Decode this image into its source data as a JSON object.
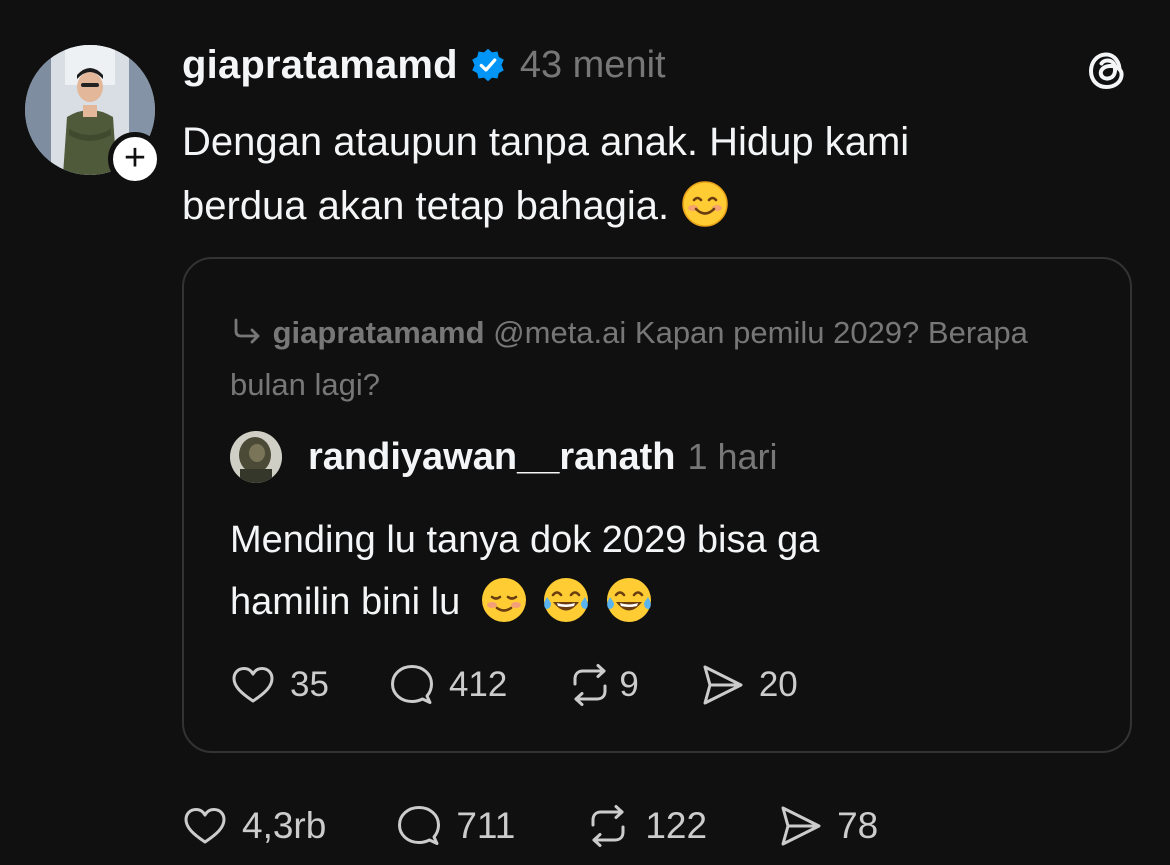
{
  "post": {
    "username": "giapratamamd",
    "time": "43 menit",
    "text_line1": "Dengan ataupun tanpa anak.  Hidup kami",
    "text_line2": "berdua akan tetap bahagia.",
    "follow_symbol": "+"
  },
  "quote": {
    "reply_user": "giapratamamd",
    "reply_text": "@meta.ai Kapan pemilu 2029? Berapa bulan lagi?",
    "username": "randiyawan__ranath",
    "time": "1 hari",
    "text_line1": "Mending lu tanya dok 2029 bisa ga",
    "text_line2": "hamilin bini lu",
    "likes": "35",
    "replies": "412",
    "reposts": "9",
    "shares": "20"
  },
  "actions": {
    "likes": "4,3rb",
    "replies": "711",
    "reposts": "122",
    "shares": "78"
  },
  "colors": {
    "background": "#101010",
    "primary_text": "#f3f5f7",
    "secondary_text": "#777777",
    "verified": "#0095f6",
    "card_border": "#333333"
  },
  "icons": [
    "threads-logo-icon",
    "verified-icon",
    "reply-arrow-icon",
    "heart-icon",
    "comment-icon",
    "repost-icon",
    "share-icon",
    "smiling-face-emoji",
    "tears-of-joy-emoji"
  ]
}
